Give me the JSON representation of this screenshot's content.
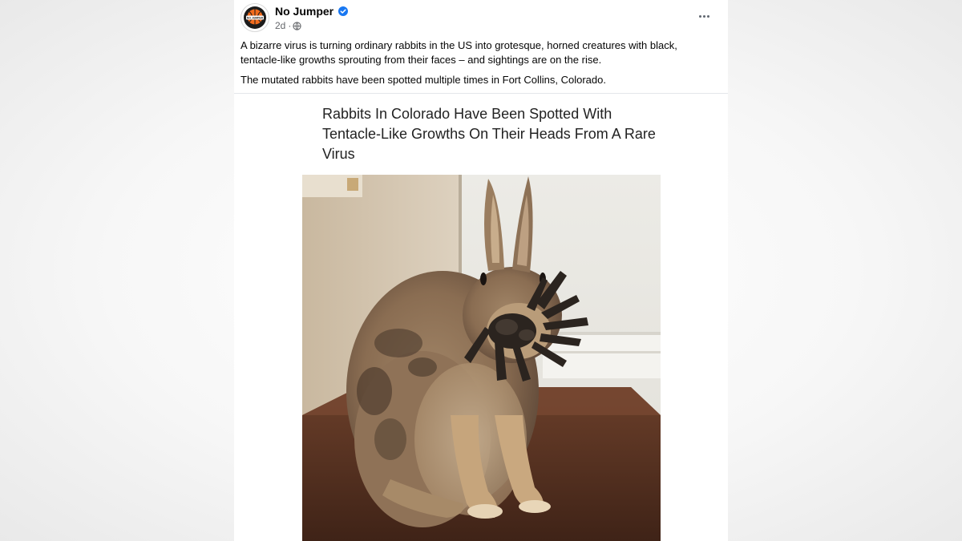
{
  "post": {
    "author": "No Jumper",
    "timestamp": "2d",
    "separator": "·",
    "audience_icon": "globe-icon",
    "verified_icon": "verified-badge-icon",
    "menu_icon": "more-options-icon",
    "avatar_text": "NO JUMPER",
    "paragraphs": [
      "A bizarre virus is turning ordinary rabbits in the US into grotesque, horned creatures with black, tentacle-like growths sprouting from their faces – and sightings are on the rise.",
      "The mutated rabbits have been spotted multiple times in Fort Collins, Colorado."
    ]
  },
  "card": {
    "headline": "Rabbits In Colorado Have Been Spotted With Tentacle-Like Growths On Their Heads From A Rare Virus",
    "image_subject": "rabbit-with-tentacle-growths"
  },
  "colors": {
    "verified": "#1877f2",
    "secondary_text": "#65676b",
    "primary_text": "#050505",
    "avatar_ring": "#f26b1d"
  }
}
